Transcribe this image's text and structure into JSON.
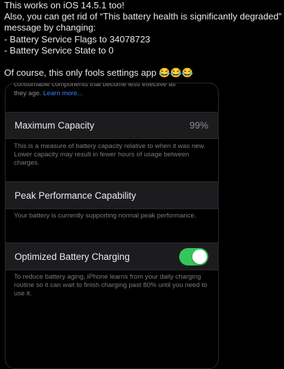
{
  "tweet": {
    "line1": "This works on iOS 14.5.1 too!",
    "line2": "Also, you can get rid of “This battery health is significantly degraded”",
    "line3": "message by changing:",
    "line4": "- Battery Service Flags to 34078723",
    "line5": "- Battery Service State to 0",
    "line6": "Of course, this only fools settings app 😂😂😂"
  },
  "settings": {
    "intro_cut_text_1": "consumable components that become less effective as",
    "intro_cut_text_2": "they age.",
    "learn_more_link": "Learn more...",
    "max_capacity": {
      "label": "Maximum Capacity",
      "value": "99%",
      "footer": "This is a measure of battery capacity relative to when it was new. Lower capacity may result in fewer hours of usage between charges."
    },
    "peak_performance": {
      "label": "Peak Performance Capability",
      "footer": "Your battery is currently supporting normal peak performance."
    },
    "optimized_charging": {
      "label": "Optimized Battery Charging",
      "enabled": true,
      "footer": "To reduce battery aging, iPhone learns from your daily charging routine so it can wait to finish charging past 80% until you need to use it."
    }
  },
  "colors": {
    "background": "#000000",
    "cell": "#1c1c1e",
    "toggle_on": "#34c759",
    "link": "#3a82f7",
    "secondary_text": "#8e8e93"
  }
}
